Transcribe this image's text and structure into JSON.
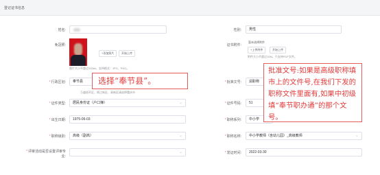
{
  "header": {
    "title": "登记证书信息"
  },
  "labels": {
    "name": "姓名:",
    "gender": "性别:",
    "photo": "免冠照:",
    "cert_attach": "证书附件:",
    "region": "*行政区划:",
    "approval_no": "*批准文号:",
    "id_type": "*证件类型:",
    "id_no": "*证件号码:",
    "birth": "*出生日期:",
    "title_series": "*职称系列:",
    "title_level": "*职称级别:",
    "title_name": "*职称名称:",
    "review_org": "*评审活动是否设置评审专业:",
    "issue_date": "*发证时间:"
  },
  "fields": {
    "gender": "男性",
    "region": "奉节县",
    "approval_no": "渝职称",
    "id_type": "居民身份证（户口簿）",
    "id_no": "51",
    "birth": "1975-06-03",
    "title_series": "中小学",
    "title_level": "高级（副高）",
    "title_name": "中小学教师（含幼儿园）_高级教师",
    "issue_date": "2022-03-30"
  },
  "photo": {
    "add_button": "+添加照片",
    "upload_button": "开始上传",
    "hint": "图片大小不超过200kb，支持格式：JPG、PNG。"
  },
  "attachment": {
    "empty_text": "暂未选择附件",
    "upload_button": "+上传附件",
    "start_button": "开始上传",
    "hint": "附件大小不超过10M，只支持PDF文件。"
  },
  "region_hint": "万盛经开区、两江新区、高新区请选择重庆市",
  "annotations": {
    "region_note": "选择“奉节县”。",
    "approval_note": "批准文号:如果是高级职称填市上的文件号,在我们下发的职称文件里面有,如果中初级填“奉节职办通”的那个文号。"
  }
}
